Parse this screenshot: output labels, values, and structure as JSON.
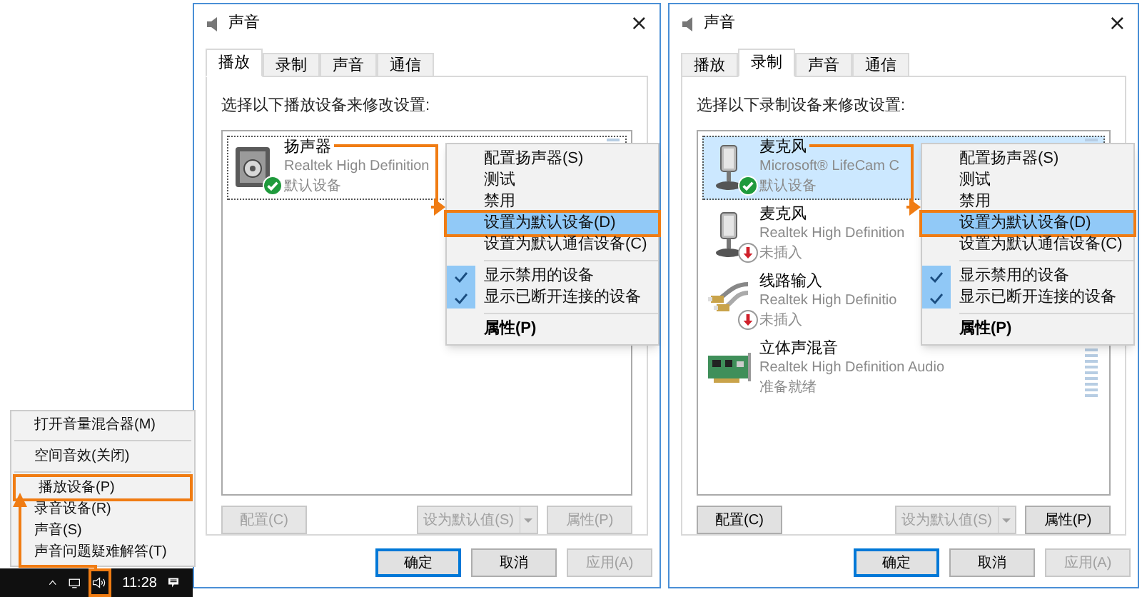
{
  "windows": [
    {
      "title": "声音",
      "close_glyph": "×",
      "tabs": [
        {
          "label": "播放",
          "selected": true
        },
        {
          "label": "录制",
          "selected": false
        },
        {
          "label": "声音",
          "selected": false
        },
        {
          "label": "通信",
          "selected": false
        }
      ],
      "instruction": "选择以下播放设备来修改设置:",
      "devices": [
        {
          "kind": "speaker",
          "name": "扬声器",
          "description": "Realtek High Definition",
          "status": "默认设备",
          "is_default": true,
          "unplugged": false,
          "selected": false,
          "focused": true,
          "meter": true
        }
      ],
      "context_menu": {
        "items": [
          {
            "kind": "item",
            "label": "配置扬声器(S)",
            "checked": false,
            "highlighted": false
          },
          {
            "kind": "item",
            "label": "测试",
            "checked": false,
            "highlighted": false
          },
          {
            "kind": "item",
            "label": "禁用",
            "checked": false,
            "highlighted": false
          },
          {
            "kind": "item",
            "label": "设置为默认设备(D)",
            "checked": false,
            "highlighted": true
          },
          {
            "kind": "item",
            "label": "设置为默认通信设备(C)",
            "checked": false,
            "highlighted": false
          },
          {
            "kind": "separator"
          },
          {
            "kind": "item",
            "label": "显示禁用的设备",
            "checked": true,
            "highlighted": false
          },
          {
            "kind": "item",
            "label": "显示已断开连接的设备",
            "checked": true,
            "highlighted": false
          },
          {
            "kind": "separator"
          },
          {
            "kind": "default_item",
            "label": "属性(P)",
            "checked": false,
            "highlighted": false
          }
        ]
      },
      "buttons": [
        {
          "kind": "plain",
          "label": "配置(C)",
          "disabled": true
        },
        {
          "kind": "split",
          "label": "设为默认值(S)",
          "disabled": true
        },
        {
          "kind": "plain",
          "label": "属性(P)",
          "disabled": true
        }
      ],
      "dialog_buttons": [
        {
          "label": "确定",
          "disabled": false,
          "default": true
        },
        {
          "label": "取消",
          "disabled": false,
          "default": false
        },
        {
          "label": "应用(A)",
          "disabled": true,
          "default": false
        }
      ]
    },
    {
      "title": "声音",
      "close_glyph": "×",
      "tabs": [
        {
          "label": "播放",
          "selected": false
        },
        {
          "label": "录制",
          "selected": true
        },
        {
          "label": "声音",
          "selected": false
        },
        {
          "label": "通信",
          "selected": false
        }
      ],
      "instruction": "选择以下录制设备来修改设置:",
      "devices": [
        {
          "kind": "microphone",
          "name": "麦克风",
          "description": "Microsoft® LifeCam C",
          "status": "默认设备",
          "is_default": true,
          "unplugged": false,
          "selected": true,
          "focused": true,
          "meter": true
        },
        {
          "kind": "microphone",
          "name": "麦克风",
          "description": "Realtek High Definition",
          "status": "未插入",
          "is_default": false,
          "unplugged": true,
          "selected": false,
          "focused": false,
          "meter": false
        },
        {
          "kind": "line_in",
          "name": "线路输入",
          "description": "Realtek High Definitio",
          "status": "未插入",
          "is_default": false,
          "unplugged": true,
          "selected": false,
          "focused": false,
          "meter": false
        },
        {
          "kind": "sound_card",
          "name": "立体声混音",
          "description": "Realtek High Definition Audio",
          "status": "准备就绪",
          "is_default": false,
          "unplugged": false,
          "selected": false,
          "focused": false,
          "meter": true
        }
      ],
      "context_menu": {
        "items": [
          {
            "kind": "item",
            "label": "配置扬声器(S)",
            "checked": false,
            "highlighted": false
          },
          {
            "kind": "item",
            "label": "测试",
            "checked": false,
            "highlighted": false
          },
          {
            "kind": "item",
            "label": "禁用",
            "checked": false,
            "highlighted": false
          },
          {
            "kind": "item",
            "label": "设置为默认设备(D)",
            "checked": false,
            "highlighted": true
          },
          {
            "kind": "item",
            "label": "设置为默认通信设备(C)",
            "checked": false,
            "highlighted": false
          },
          {
            "kind": "separator"
          },
          {
            "kind": "item",
            "label": "显示禁用的设备",
            "checked": true,
            "highlighted": false
          },
          {
            "kind": "item",
            "label": "显示已断开连接的设备",
            "checked": true,
            "highlighted": false
          },
          {
            "kind": "separator"
          },
          {
            "kind": "default_item",
            "label": "属性(P)",
            "checked": false,
            "highlighted": false
          }
        ]
      },
      "buttons": [
        {
          "kind": "plain",
          "label": "配置(C)",
          "disabled": false
        },
        {
          "kind": "split",
          "label": "设为默认值(S)",
          "disabled": true
        },
        {
          "kind": "plain",
          "label": "属性(P)",
          "disabled": false
        }
      ],
      "dialog_buttons": [
        {
          "label": "确定",
          "disabled": false,
          "default": true
        },
        {
          "label": "取消",
          "disabled": false,
          "default": false
        },
        {
          "label": "应用(A)",
          "disabled": true,
          "default": false
        }
      ]
    }
  ],
  "tray_menu": {
    "items": [
      {
        "kind": "item",
        "label": "打开音量混合器(M)",
        "highlighted": false
      },
      {
        "kind": "separator"
      },
      {
        "kind": "item",
        "label": "空间音效(关闭)",
        "highlighted": false
      },
      {
        "kind": "separator"
      },
      {
        "kind": "item",
        "label": "播放设备(P)",
        "highlighted": true
      },
      {
        "kind": "item",
        "label": "录音设备(R)",
        "highlighted": false
      },
      {
        "kind": "item",
        "label": "声音(S)",
        "highlighted": false
      },
      {
        "kind": "item",
        "label": "声音问题疑难解答(T)",
        "highlighted": false
      }
    ]
  },
  "taskbar": {
    "time": "11:28"
  }
}
